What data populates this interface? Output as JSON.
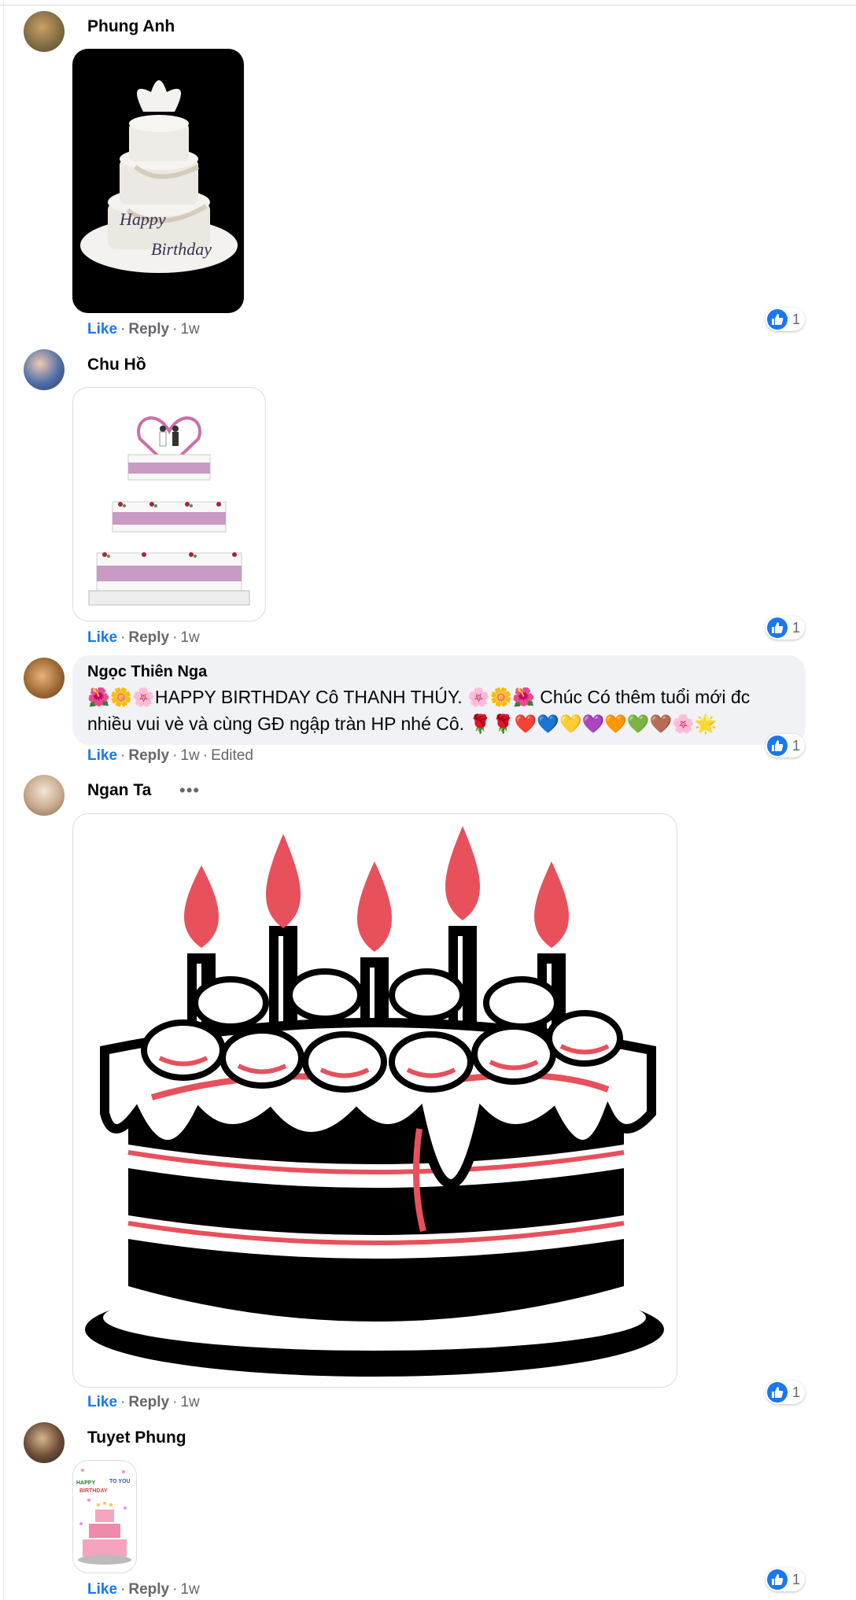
{
  "comments": [
    {
      "author": "Phung Anh",
      "like": "Like",
      "reply": "Reply",
      "time": "1w",
      "reactions": "1",
      "media": "Happy Birthday white cake",
      "media_text_1": "Happy",
      "media_text_2": "Birthday"
    },
    {
      "author": "Chu Hồ",
      "like": "Like",
      "reply": "Reply",
      "time": "1w",
      "reactions": "1",
      "media": "pink wedding cake sticker"
    },
    {
      "author": "Ngọc Thiên Nga",
      "like": "Like",
      "reply": "Reply",
      "time": "1w",
      "edited": "Edited",
      "reactions": "1",
      "text": "🌺🌼🌸HAPPY BIRTHDAY Cô THANH THÚY. 🌸🌼🌺 Chúc Có thêm tuổi mới đc nhiều vui vè và cùng GĐ ngập tràn HP nhé Cô. 🌹🌹❤️💙💛💜🧡💚🤎🌸🌟"
    },
    {
      "author": "Ngan Ta",
      "like": "Like",
      "reply": "Reply",
      "time": "1w",
      "reactions": "1",
      "more": "•••",
      "media": "cartoon cake with candles"
    },
    {
      "author": "Tuyet Phung",
      "like": "Like",
      "reply": "Reply",
      "time": "1w",
      "reactions": "1",
      "media": "birthday cake gif",
      "media_text_1": "HAPPY",
      "media_text_2": "BIRTHDAY",
      "media_text_3": "TO YOU"
    }
  ],
  "colors": {
    "accent": "#1877f2",
    "muted": "#65676b",
    "bubble": "#f0f2f5",
    "cake_red": "#e8505b"
  },
  "icons": [
    "like-thumb-icon",
    "more-options-icon"
  ]
}
